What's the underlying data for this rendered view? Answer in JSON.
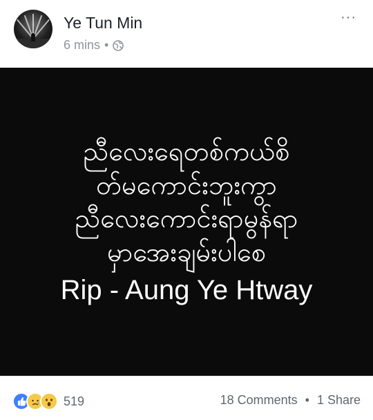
{
  "post": {
    "author_name": "Ye Tun Min",
    "timestamp": "6 mins",
    "meta_separator": "•",
    "privacy_icon": "globe-icon",
    "more_icon": "···"
  },
  "content": {
    "lines": [
      "ညီလေးရေတစ်ကယ်စိ",
      "တ်မကောင်းဘူးကွာ",
      "ညီလေးကောင်းရာမွန်ရာ",
      "မှာအေးချမ်းပါစေ",
      "Rip - Aung Ye Htway"
    ],
    "background_color": "#0b0b0b",
    "text_color": "#ffffff"
  },
  "footer": {
    "reaction_icons": [
      "like-icon",
      "sad-icon",
      "wow-icon"
    ],
    "reaction_count": "519",
    "comments": "18 Comments",
    "separator": "•",
    "shares": "1 Share"
  }
}
